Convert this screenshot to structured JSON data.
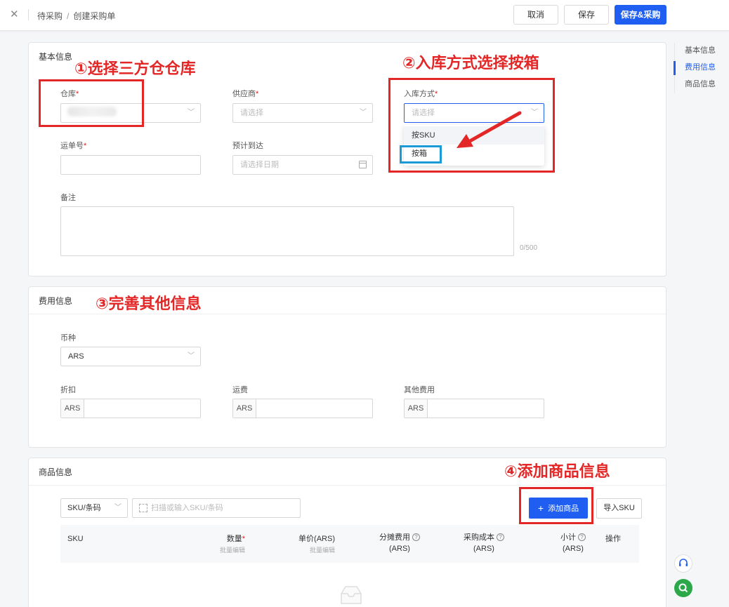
{
  "topbar": {
    "close_icon": "close-icon",
    "breadcrumb": [
      "待采购",
      "创建采购单"
    ],
    "breadcrumb_sep": "/",
    "cancel_label": "取消",
    "save_label": "保存",
    "save_purchase_label": "保存&采购"
  },
  "anchor_nav": {
    "items": [
      "基本信息",
      "费用信息",
      "商品信息"
    ],
    "active": "费用信息"
  },
  "basic": {
    "title": "基本信息",
    "warehouse_label": "仓库",
    "supplier_label": "供应商",
    "supplier_placeholder": "请选择",
    "inbound_label": "入库方式",
    "inbound_placeholder": "请选择",
    "inbound_options": [
      "按SKU",
      "按箱"
    ],
    "tracking_label": "运单号",
    "eta_label": "预计到达",
    "eta_placeholder": "请选择日期",
    "remark_label": "备注",
    "remark_counter": "0/500"
  },
  "fees": {
    "title": "费用信息",
    "currency_label": "币种",
    "currency_value": "ARS",
    "discount_label": "折扣",
    "freight_label": "运费",
    "other_label": "其他费用",
    "prefix": "ARS"
  },
  "products": {
    "title": "商品信息",
    "search_type": "SKU/条码",
    "search_placeholder": "扫描或输入SKU/条码",
    "add_label": "添加商品",
    "import_label": "导入SKU",
    "columns": {
      "sku": "SKU",
      "qty": "数量",
      "qty_sub": "批量编辑",
      "price": "单价(ARS)",
      "price_sub": "批量编辑",
      "alloc": "分摊费用",
      "alloc_unit": "(ARS)",
      "cost": "采购成本",
      "cost_unit": "(ARS)",
      "subtotal": "小计",
      "subtotal_unit": "(ARS)",
      "ops": "操作"
    }
  },
  "annotations": {
    "a1": "①选择三方仓仓库",
    "a2": "②入库方式选择按箱",
    "a3": "③完善其他信息",
    "a4": "④添加商品信息"
  },
  "colors": {
    "primary": "#1f5ef0",
    "annotation": "#e32626",
    "highlight_box": "#1a9ad6",
    "required": "#e02020"
  }
}
